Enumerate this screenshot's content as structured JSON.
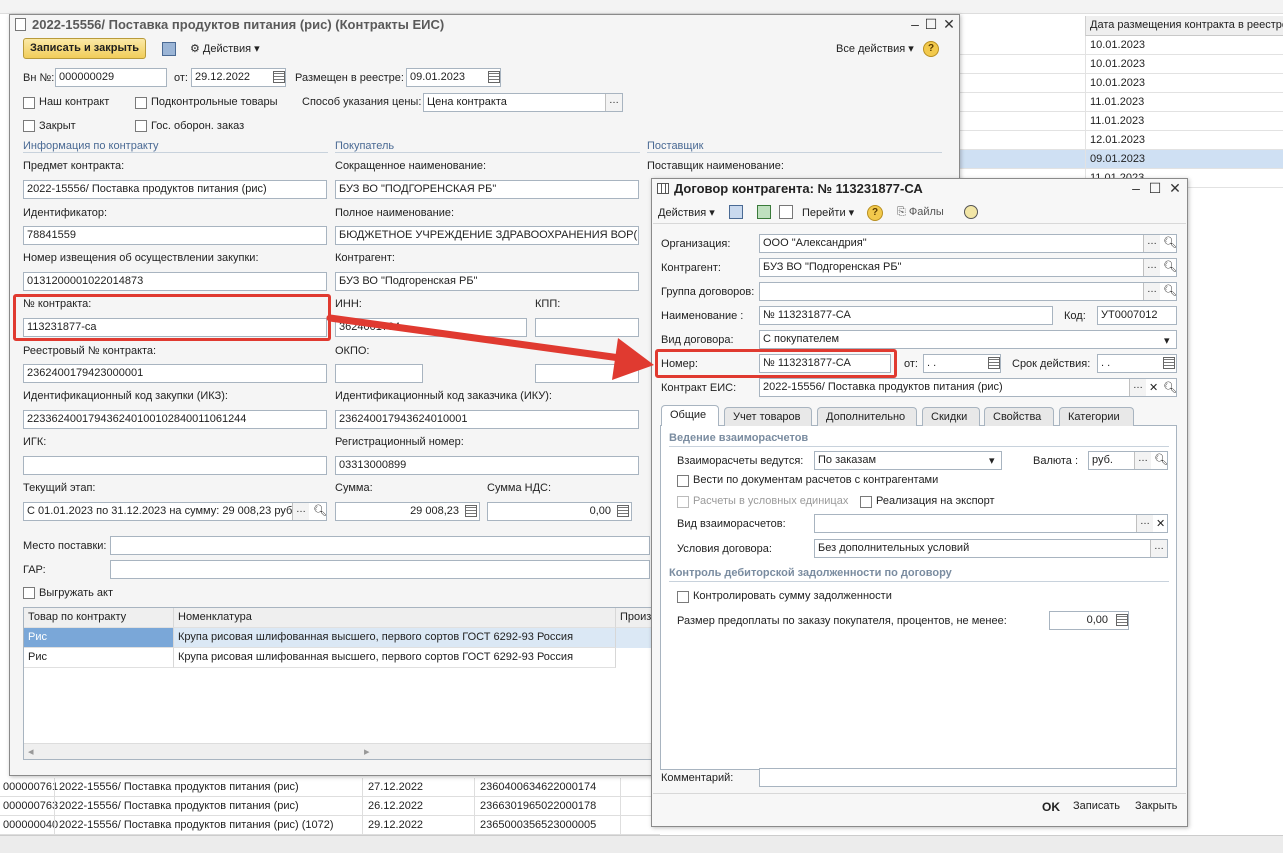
{
  "bg": {
    "header_right": "Дата размещения контракта в реестре",
    "dates": [
      "10.01.2023",
      "10.01.2023",
      "10.01.2023",
      "11.01.2023",
      "11.01.2023",
      "12.01.2023",
      "09.01.2023",
      "11.01.2023"
    ],
    "bottom_rows": [
      {
        "id": "000000761",
        "name": "2022-15556/ Поставка продуктов питания (рис)",
        "date": "27.12.2022",
        "reg": "2360400634622000174"
      },
      {
        "id": "000000763",
        "name": "2022-15556/ Поставка продуктов питания (рис)",
        "date": "26.12.2022",
        "reg": "2366301965022000178"
      },
      {
        "id": "000000040",
        "name": "2022-15556/ Поставка продуктов питания (рис) (1072)",
        "date": "29.12.2022",
        "reg": "2365000356523000005"
      }
    ]
  },
  "main": {
    "title": "2022-15556/ Поставка продуктов питания (рис) (Контракты ЕИС)",
    "toolbar": {
      "save_close": "Записать и закрыть",
      "actions": "Действия",
      "all_actions": "Все действия",
      "help": "?"
    },
    "vn_label": "Вн №:",
    "vn_value": "000000029",
    "from_label": "от:",
    "from_value": "29.12.2022",
    "registry_label": "Размещен в реестре:",
    "registry_value": "09.01.2023",
    "our_contract": "Наш контракт",
    "controlled_goods": "Подконтрольные товары",
    "price_method_label": "Способ указания цены:",
    "price_method_value": "Цена контракта",
    "closed": "Закрыт",
    "gos_oboron": "Гос. оборон. заказ",
    "group_info": "Информация по контракту",
    "group_buyer": "Покупатель",
    "group_supplier": "Поставщик",
    "subject_label": "Предмет контракта:",
    "subject_value": "2022-15556/ Поставка продуктов питания (рис)",
    "short_name_label": "Сокращенное наименование:",
    "short_name_value": "БУЗ ВО \"ПОДГОРЕНСКАЯ РБ\"",
    "supplier_name_label": "Поставщик наименование:",
    "identifier_label": "Идентификатор:",
    "identifier_value": "78841559",
    "full_name_label": "Полное наименование:",
    "full_name_value": "БЮДЖЕТНОЕ УЧРЕЖДЕНИЕ ЗДРАВООХРАНЕНИЯ ВОР(",
    "notice_label": "Номер извещения об осуществлении закупки:",
    "notice_value": "0131200001022014873",
    "counterparty_label": "Контрагент:",
    "counterparty_value": "БУЗ ВО \"Подгоренская РБ\"",
    "contract_no_label": "№ контракта:",
    "contract_no_value": "113231877-са",
    "inn_label": "ИНН:",
    "inn_value": "3624001794",
    "kpp_label": "КПП:",
    "reg_no_label": "Реестровый № контракта:",
    "reg_no_value": "2362400179423000001",
    "okpo_label": "ОКПО:",
    "ikz_label": "Идентификационный код закупки (ИКЗ):",
    "ikz_value": "223362400179436240100102840011061244",
    "iku_label": "Идентификационный код заказчика (ИКУ):",
    "iku_value": "236240017943624010001",
    "igk_label": "ИГК:",
    "regnum_label": "Регистрационный номер:",
    "regnum_value": "03313000899",
    "stage_label": "Текущий этап:",
    "stage_value": "С 01.01.2023 по 31.12.2023 на сумму: 29 008,23 руб.",
    "sum_label": "Сумма:",
    "sum_value": "29 008,23",
    "vat_label": "Сумма НДС:",
    "vat_value": "0,00",
    "place_label": "Место поставки:",
    "gar_label": "ГАР:",
    "export_act": "Выгружать акт",
    "table": {
      "headers": [
        "Товар по контракту",
        "Номенклатура",
        "Произ"
      ],
      "rows": [
        {
          "good": "Рис",
          "nom": "Крупа рисовая шлифованная высшего, первого сортов ГОСТ 6292-93 Россия"
        },
        {
          "good": "Рис",
          "nom": "Крупа рисовая шлифованная высшего, первого сортов ГОСТ 6292-93 Россия"
        }
      ]
    }
  },
  "dlg": {
    "title": "Договор контрагента: № 113231877-СА",
    "toolbar": {
      "actions": "Действия",
      "go": "Перейти",
      "files": "Файлы",
      "help": "?"
    },
    "org_label": "Организация:",
    "org_value": "ООО \"Александрия\"",
    "cp_label": "Контрагент:",
    "cp_value": "БУЗ ВО \"Подгоренская РБ\"",
    "group_label": "Группа договоров:",
    "name_label": "Наименование :",
    "name_value": "№ 113231877-СА",
    "code_label": "Код:",
    "code_value": "УТ0007012",
    "type_label": "Вид договора:",
    "type_value": "С покупателем",
    "number_label": "Номер:",
    "number_value": "№ 113231877-СА",
    "from_label": "от:",
    "from_value": " .  .",
    "validity_label": "Срок действия:",
    "validity_value": " .  .",
    "eis_label": "Контракт ЕИС:",
    "eis_value": "2022-15556/ Поставка продуктов питания (рис)",
    "tabs": [
      "Общие",
      "Учет товаров",
      "Дополнительно",
      "Скидки",
      "Свойства",
      "Категории"
    ],
    "settlements_title": "Ведение взаиморасчетов",
    "settle_by_label": "Взаиморасчеты ведутся:",
    "settle_by_value": "По заказам",
    "currency_label": "Валюта :",
    "currency_value": "руб.",
    "by_docs": "Вести по документам расчетов с контрагентами",
    "conv_units": "Расчеты в условных единицах",
    "export_sale": "Реализация на экспорт",
    "settle_type_label": "Вид взаиморасчетов:",
    "terms_label": "Условия договора:",
    "terms_value": "Без дополнительных условий",
    "debt_title": "Контроль дебиторской задолженности по договору",
    "control_debt": "Контролировать сумму задолженности",
    "prepay_label": "Размер предоплаты по заказу покупателя, процентов, не менее:",
    "prepay_value": "0,00",
    "comment_label": "Комментарий:",
    "ok": "OK",
    "save": "Записать",
    "close": "Закрыть"
  },
  "colors": {
    "accent_red": "#e03a30",
    "selection": "#cfe0f3",
    "group_title": "#4a6a94"
  }
}
